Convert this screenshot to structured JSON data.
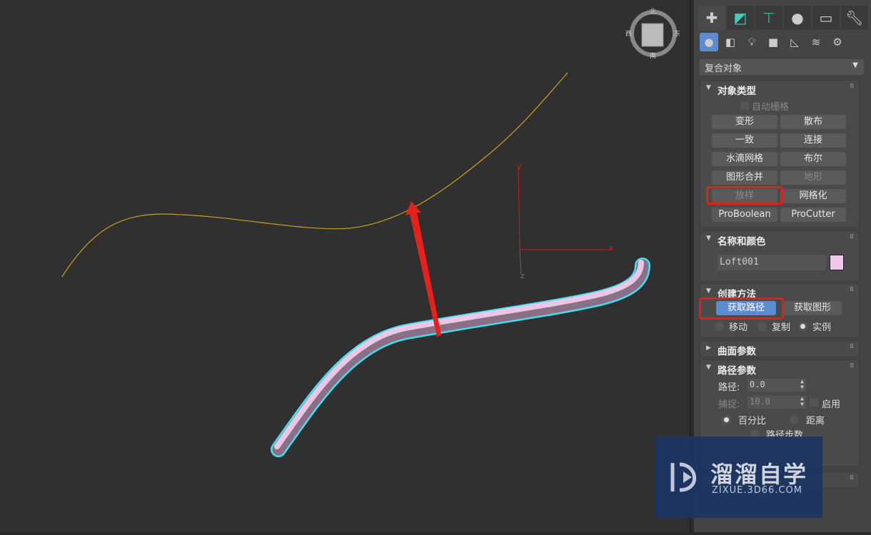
{
  "viewport": {
    "viewcube": {
      "north": "北",
      "east": "东",
      "south": "南",
      "west": "西"
    },
    "axis": {
      "x": "x",
      "y": "y",
      "z": "z"
    },
    "colors": {
      "path_curve": "#c8a020",
      "object": "#e8c0e0",
      "selection": "#40e0f0",
      "arrow": "#e8201c"
    }
  },
  "panel": {
    "tabs": [
      {
        "icon": "plus-icon"
      },
      {
        "icon": "modify-icon"
      },
      {
        "icon": "hierarchy-icon"
      },
      {
        "icon": "motion-icon"
      },
      {
        "icon": "display-icon"
      },
      {
        "icon": "utilities-icon"
      }
    ],
    "subtabs": [
      {
        "icon": "geometry-icon"
      },
      {
        "icon": "shapes-icon"
      },
      {
        "icon": "lights-icon"
      },
      {
        "icon": "cameras-icon"
      },
      {
        "icon": "helpers-icon"
      },
      {
        "icon": "spacewarps-icon"
      },
      {
        "icon": "systems-icon"
      }
    ],
    "category": "复合对象",
    "object_type": {
      "title": "对象类型",
      "autogrid": "自动栅格",
      "buttons": [
        "变形",
        "散布",
        "一致",
        "连接",
        "水滴网格",
        "布尔",
        "图形合并",
        "地形",
        "放样",
        "网格化",
        "ProBoolean",
        "ProCutter"
      ]
    },
    "name_color": {
      "title": "名称和颜色",
      "name": "Loft001",
      "color": "#f0c8ec"
    },
    "creation": {
      "title": "创建方法",
      "get_path": "获取路径",
      "get_shape": "获取图形",
      "move": "移动",
      "copy": "复制",
      "instance": "实例"
    },
    "surface": {
      "title": "曲面参数"
    },
    "path_params": {
      "title": "路径参数",
      "path_label": "路径:",
      "path_value": "0.0",
      "snap_label": "捕捉:",
      "snap_value": "10.0",
      "enable": "启用",
      "percent": "百分比",
      "distance": "距离",
      "path_steps": "路径步数"
    }
  },
  "watermark": {
    "title": "溜溜自学",
    "url": "ZIXUE.3D66.COM"
  }
}
